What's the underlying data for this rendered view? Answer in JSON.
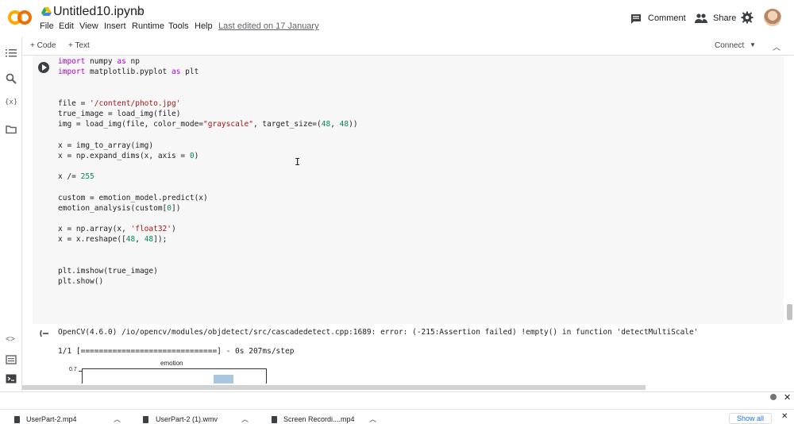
{
  "header": {
    "title": "Untitled10.ipynb",
    "menu": [
      "File",
      "Edit",
      "View",
      "Insert",
      "Runtime",
      "Tools",
      "Help"
    ],
    "last_edited": "Last edited on 17 January",
    "comment_label": "Comment",
    "share_label": "Share"
  },
  "toolbar": {
    "add_code": "+ Code",
    "add_text": "+ Text",
    "connect": "Connect"
  },
  "cell": {
    "lines": [
      "import numpy as np",
      "import matplotlib.pyplot as plt",
      "",
      "",
      "file = '/content/photo.jpg'",
      "true_image = load_img(file)",
      "img = load_img(file, color_mode=\"grayscale\", target_size=(48, 48))",
      "",
      "x = img_to_array(img)",
      "x = np.expand_dims(x, axis = 0)",
      "",
      "x /= 255",
      "",
      "custom = emotion_model.predict(x)",
      "emotion_analysis(custom[0])",
      "",
      "x = np.array(x, 'float32')",
      "x = x.reshape([48, 48]);",
      "",
      "",
      "plt.imshow(true_image)",
      "plt.show()"
    ]
  },
  "output": {
    "error_line": "OpenCV(4.6.0) /io/opencv/modules/objdetect/src/cascadedetect.cpp:1689: error: (-215:Assertion failed) !empty() in function 'detectMultiScale'",
    "progress_line": "1/1 [==============================] - 0s 207ms/step",
    "chart_title": "emotion",
    "chart_ytick": "0.7"
  },
  "downloads": {
    "items": [
      "UserPart-2.mp4",
      "UserPart-2 (1).wmv",
      "Screen Recordi....mp4"
    ],
    "show_all": "Show all"
  },
  "colors": {
    "accent": "#1a73e8",
    "logo_orange": "#f9ab00",
    "logo_dark_orange": "#e8710a",
    "chart_bar": "#a8c6e0"
  }
}
